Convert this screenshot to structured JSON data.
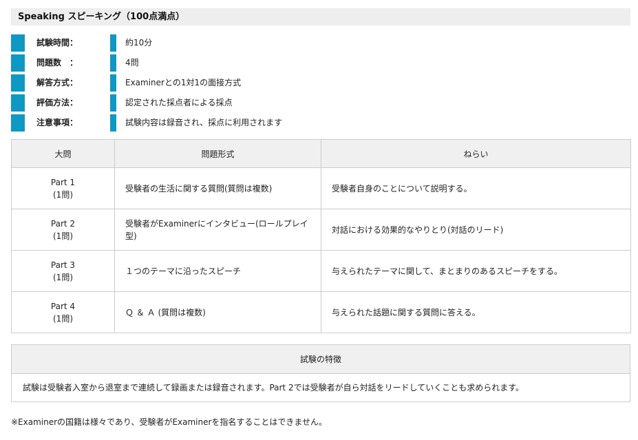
{
  "header": {
    "title": "Speaking スピーキング（100点満点）"
  },
  "info": [
    {
      "label": "試験時間：",
      "value": "約10分"
    },
    {
      "label": "問題数　：",
      "value": "4問"
    },
    {
      "label": "解答方式：",
      "value": "Examinerとの1対1の面接方式"
    },
    {
      "label": "評価方法：",
      "value": "認定された採点者による採点"
    },
    {
      "label": "注意事項：",
      "value": "試験内容は録音され、採点に利用されます"
    }
  ],
  "colors": {
    "accent": "#0d99c4",
    "header_bg": "#f0f0f0",
    "border": "#cccccc"
  },
  "table": {
    "headers": [
      "大問",
      "問題形式",
      "ねらい"
    ],
    "rows": [
      {
        "part": "Part 1",
        "count": "(1問)",
        "format": "受験者の生活に関する質問(質問は複数)",
        "aim": "受験者自身のことについて説明する。"
      },
      {
        "part": "Part 2",
        "count": "(1問)",
        "format": "受験者がExaminerにインタビュー(ロールプレイ型)",
        "aim": "対話における効果的なやりとり(対話のリード)"
      },
      {
        "part": "Part 3",
        "count": "(1問)",
        "format": "１つのテーマに沿ったスピーチ",
        "aim": "与えられたテーマに関して、まとまりのあるスピーチをする。"
      },
      {
        "part": "Part 4",
        "count": "(1問)",
        "format": "Ｑ ＆ Ａ (質問は複数)",
        "aim": "与えられた話題に関する質問に答える。"
      }
    ]
  },
  "features": {
    "title": "試験の特徴",
    "body": "試験は受験者入室から退室まで連続して録画または録音されます。Part 2では受験者が自ら対話をリードしていくことも求められます。"
  },
  "footnote": "※Examinerの国籍は様々であり、受験者がExaminerを指名することはできません。"
}
